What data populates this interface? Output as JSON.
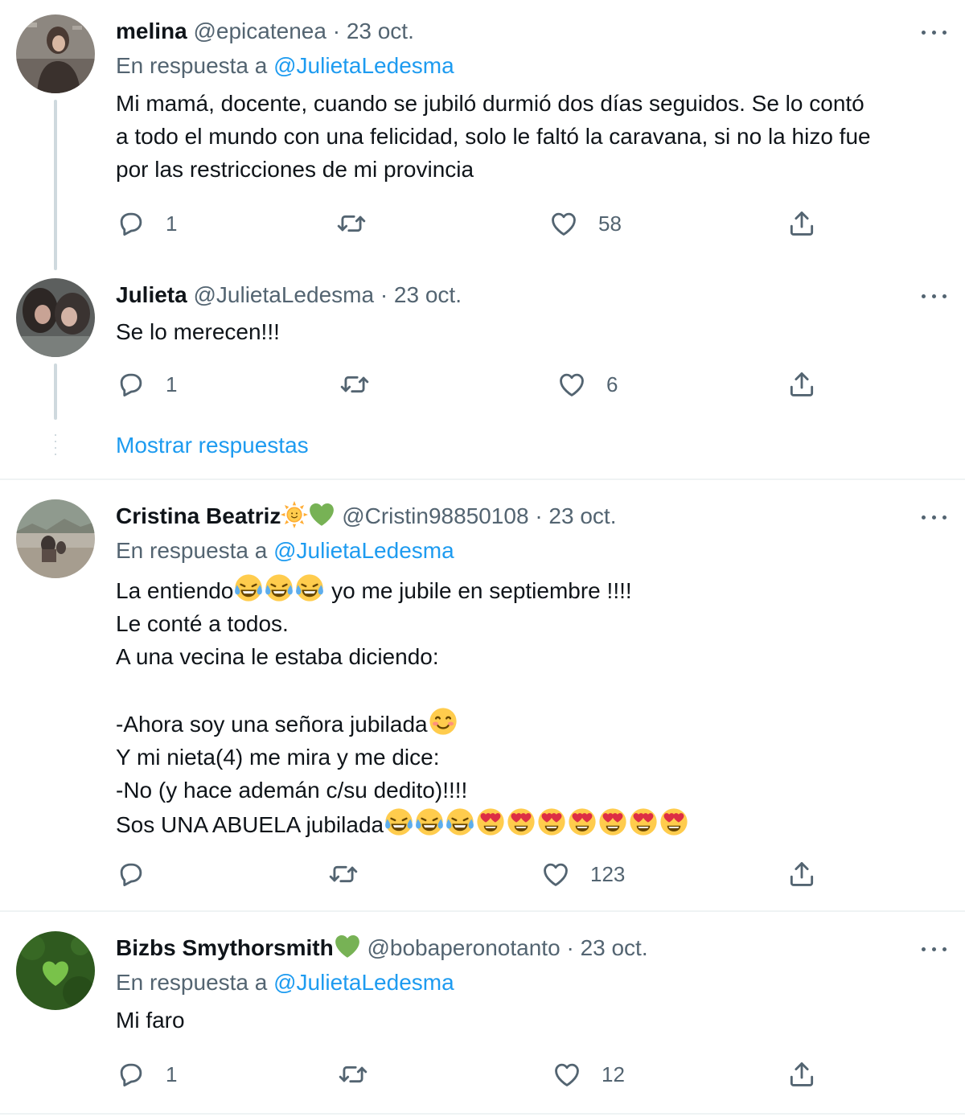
{
  "tweets": [
    {
      "name": "melina",
      "handle": "@epicatenea",
      "separator": "·",
      "time": "23 oct.",
      "reply_prefix": "En respuesta a",
      "reply_to": "@JulietaLedesma",
      "lines": [
        "Mi mamá, docente, cuando se jubiló durmió dos días seguidos. Se lo contó",
        "a todo el mundo con una felicidad, solo le faltó la caravana, si no la hizo fue",
        "por las restricciones de mi provincia"
      ],
      "reply_count": "1",
      "retweet_count": "",
      "like_count": "58"
    },
    {
      "name": "Julieta",
      "handle": "@JulietaLedesma",
      "separator": "·",
      "time": "23 oct.",
      "lines": [
        "Se lo merecen!!!"
      ],
      "reply_count": "1",
      "retweet_count": "",
      "like_count": "6"
    },
    {
      "name": "Cristina Beatriz",
      "handle": "@Cristin98850108",
      "separator": "·",
      "time": "23 oct.",
      "reply_prefix": "En respuesta a",
      "reply_to": "@JulietaLedesma",
      "lines": [
        "La entiendo",
        " yo me jubile en septiembre !!!!",
        "Le conté a todos.",
        "A una vecina le estaba diciendo:",
        "-Ahora soy una señora jubilada",
        "Y mi nieta(4) me mira y me dice:",
        "-No (y hace ademán c/su dedito)!!!!",
        "Sos UNA ABUELA jubilada"
      ],
      "reply_count": "",
      "retweet_count": "",
      "like_count": "123"
    },
    {
      "name": "Bizbs Smythorsmith",
      "handle": "@bobaperonotanto",
      "separator": "·",
      "time": "23 oct.",
      "reply_prefix": "En respuesta a",
      "reply_to": "@JulietaLedesma",
      "lines": [
        "Mi faro"
      ],
      "reply_count": "1",
      "retweet_count": "",
      "like_count": "12"
    }
  ],
  "show_replies_label": "Mostrar respuestas",
  "colors": {
    "text": "#0f1419",
    "secondary": "#536471",
    "link": "#1d9bf0",
    "thread_line": "#cfd9de",
    "divider": "#eff3f4"
  },
  "icons": [
    "reply-icon",
    "retweet-icon",
    "like-icon",
    "share-icon",
    "more-icon",
    "sun-emoji",
    "green-heart-emoji",
    "laughing-tears-emoji",
    "smiling-blush-emoji",
    "heart-eyes-emoji"
  ]
}
